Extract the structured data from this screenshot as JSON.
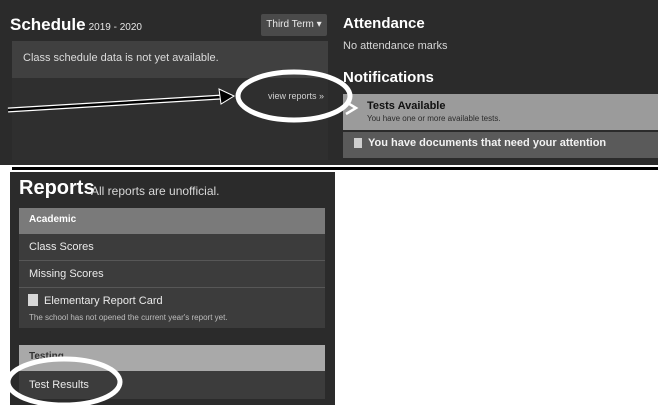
{
  "schedule": {
    "title": "Schedule",
    "year": "2019 - 2020",
    "term_button": "Third Term",
    "term_caret": "▾",
    "empty_message": "Class schedule data is not yet available.",
    "view_reports_link": "view reports »"
  },
  "attendance": {
    "title": "Attendance",
    "empty_message": "No attendance marks"
  },
  "notifications": {
    "title": "Notifications",
    "items": [
      {
        "title": "Tests Available",
        "subtitle": "You have one or more available tests.",
        "icon": "arrow-icon"
      },
      {
        "title": "You have documents that need your attention",
        "icon": "document-icon"
      }
    ]
  },
  "reports": {
    "title": "Reports",
    "subtitle": "All reports are unofficial.",
    "sections": [
      {
        "header": "Academic",
        "items": [
          {
            "label": "Class Scores"
          },
          {
            "label": "Missing Scores"
          },
          {
            "label": "Elementary Report Card",
            "icon": "report-card-icon",
            "note": "The school has not opened the current year's report yet."
          }
        ]
      },
      {
        "header": "Testing",
        "items": [
          {
            "label": "Test Results"
          }
        ]
      }
    ]
  },
  "colors": {
    "panel_bg": "#2b2b2b",
    "section_header": "#7a7a7a",
    "highlight_row": "#9b9b9b",
    "annotation_ink": "#000000"
  }
}
